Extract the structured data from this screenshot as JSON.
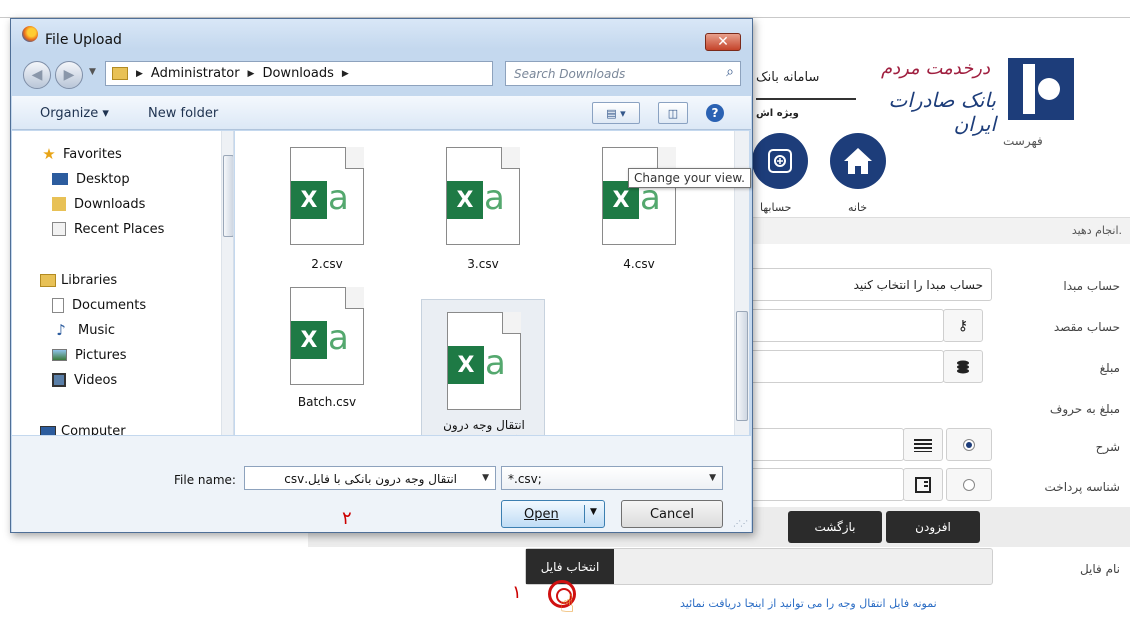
{
  "bank": {
    "slogan": "درخدمت مردم",
    "bank_name": "بانک صادرات ایران",
    "system_title": "سامانه بانک",
    "system_subtitle": "ویژه اش",
    "menu_label": "فهرست",
    "nav": {
      "home_label": "خانه",
      "accounts_label": "حسابها"
    },
    "hint": "انجام دهید.",
    "form": {
      "source_account_label": "حساب مبدا",
      "source_account_value": "حساب مبدا را انتخاب کنید",
      "dest_account_label": "حساب مقصد",
      "amount_label": "مبلغ",
      "amount_words_label": "مبلغ به حروف",
      "description_label": "شرح",
      "payment_id_label": "شناسه پرداخت"
    },
    "buttons": {
      "add_label": "افزودن",
      "back_label": "بازگشت"
    },
    "file": {
      "label": "نام فایل",
      "choose_label": "انتخاب فایل",
      "sample_link": "نمونه فایل انتقال وجه را می توانید از اینجا دریافت نمائید"
    },
    "step_markers": {
      "one": "۱",
      "two": "۲"
    }
  },
  "dialog": {
    "title": "File Upload",
    "close_glyph": "✕",
    "breadcrumb": [
      "Administrator",
      "Downloads"
    ],
    "search_placeholder": "Search Downloads",
    "toolbar": {
      "organize_label": "Organize ▾",
      "new_folder_label": "New folder"
    },
    "tooltip": "Change your view.",
    "nav_pane": {
      "favorites_label": "Favorites",
      "favorites": [
        "Desktop",
        "Downloads",
        "Recent Places"
      ],
      "libraries_label": "Libraries",
      "libraries": [
        "Documents",
        "Music",
        "Pictures",
        "Videos"
      ],
      "computer_label": "Computer"
    },
    "files": [
      {
        "name": "2.csv"
      },
      {
        "name": "3.csv"
      },
      {
        "name": "4.csv"
      },
      {
        "name": "Batch.csv"
      },
      {
        "name": "انتقال وجه درون بانکی با فایل.csv",
        "selected": true
      }
    ],
    "file_tile_parts": {
      "x": "X",
      "a": "a"
    },
    "file_name_label": "File name:",
    "file_name_value": "انتقال وجه درون بانکی با فایل.csv",
    "filter_value": "*.csv;",
    "open_label": "Open",
    "cancel_label": "Cancel"
  },
  "colors": {
    "bank_blue": "#1d3d7a",
    "excel_green": "#1e7a45",
    "accent_red": "#cc0000"
  },
  "icons": [
    "firefox-icon",
    "back-arrow-icon",
    "forward-arrow-icon",
    "folder-icon",
    "refresh-icon",
    "search-icon",
    "view-icon",
    "preview-pane-icon",
    "help-icon",
    "star-icon",
    "excel-file-icon",
    "home-icon",
    "accounts-icon",
    "radio-icon",
    "hand-pointer-icon"
  ]
}
